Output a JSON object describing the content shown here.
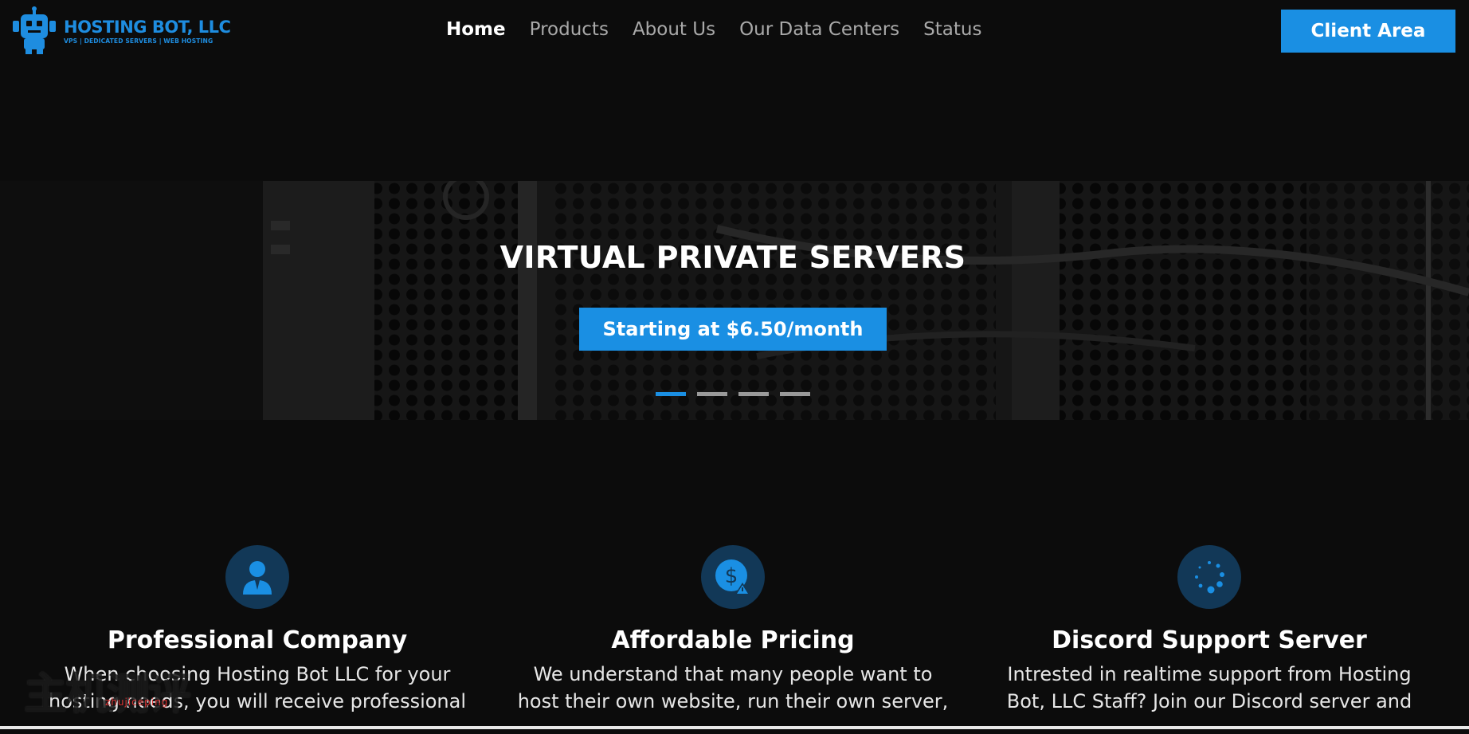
{
  "brand": {
    "name": "HOSTING BOT, LLC",
    "tagline": "VPS | DEDICATED SERVERS | WEB HOSTING",
    "accent": "#1e8de0"
  },
  "nav": {
    "items": [
      {
        "label": "Home",
        "active": true
      },
      {
        "label": "Products",
        "active": false
      },
      {
        "label": "About Us",
        "active": false
      },
      {
        "label": "Our Data Centers",
        "active": false
      },
      {
        "label": "Status",
        "active": false
      }
    ],
    "client_area": "Client Area"
  },
  "hero": {
    "title": "VIRTUAL PRIVATE SERVERS",
    "cta": "Starting at $6.50/month",
    "slides": 4,
    "active_slide": 1
  },
  "features": [
    {
      "icon": "user-icon",
      "title": "Professional Company",
      "text": "When choosing Hosting Bot LLC for your hosting needs, you will receive professional"
    },
    {
      "icon": "dollar-warning-icon",
      "title": "Affordable Pricing",
      "text": "We understand that many people want to host their own website, run their own server,"
    },
    {
      "icon": "spinner-icon",
      "title": "Discord Support Server",
      "text": "Intrested in realtime support from Hosting Bot, LLC Staff? Join our Discord server and"
    }
  ],
  "watermark": {
    "text": "主机测评",
    "sub": "zhujiceping"
  },
  "colors": {
    "background": "#0c0c0c",
    "accent": "#1a8fe3",
    "nav_inactive": "#a9a9a9",
    "icon_bg": "#123857"
  }
}
